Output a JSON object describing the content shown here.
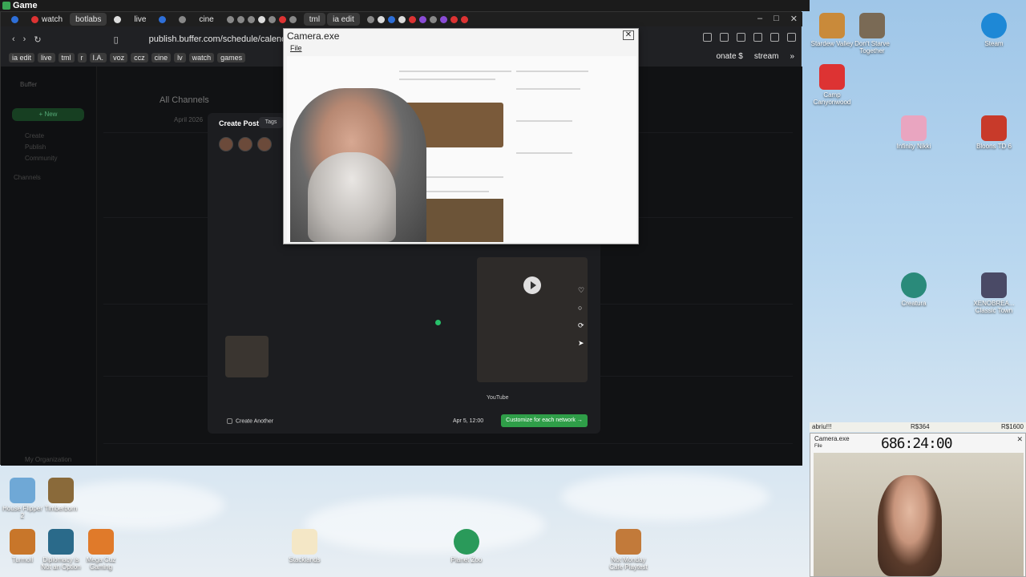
{
  "game_bar": {
    "title": "Game"
  },
  "browser": {
    "tabs": [
      {
        "label": "",
        "active": false
      },
      {
        "label": "watch",
        "active": false
      },
      {
        "label": "botlabs",
        "active": true
      },
      {
        "label": "",
        "active": false
      },
      {
        "label": "live",
        "active": false
      },
      {
        "label": "",
        "active": false
      },
      {
        "label": "",
        "active": false
      },
      {
        "label": "cine",
        "active": false
      },
      {
        "label": "",
        "active": false
      },
      {
        "label": "tml",
        "active": true
      },
      {
        "label": "ia edit",
        "active": true
      }
    ],
    "url": "publish.buffer.com/schedule/calendar",
    "bookmarks": [
      "ia edit",
      "live",
      "tml",
      "r",
      "I.A.",
      "voz",
      "ccz",
      "cine",
      "lv",
      "watch",
      "games"
    ],
    "bookmarks_right": [
      "onate $",
      "stream"
    ]
  },
  "buffer": {
    "brand": "Buffer",
    "create_label": "+ New",
    "sidebar_items": [
      "Create",
      "Publish",
      "Community",
      "Channels"
    ],
    "calendar_title": "All Channels",
    "month": "April 2026",
    "org_name": "My Organization",
    "modal": {
      "title": "Create Post",
      "tags_label": "Tags",
      "youtube_label": "YouTube",
      "create_another_label": "Create Another",
      "schedule_label": "Apr 5, 12:00",
      "customize_label": "Customize for each network →"
    }
  },
  "camera_window": {
    "title": "Camera.exe",
    "menu_file": "File"
  },
  "desktop_icons_right": [
    {
      "label": "Stardew Valley",
      "color": "#c98a3a"
    },
    {
      "label": "Don't Starve Together",
      "color": "#7a6a55"
    },
    {
      "label": "Steam",
      "color": "#1e88d6"
    },
    {
      "label": "Camp Canyonwood",
      "color": "#d33"
    },
    {
      "label": "Infinity Nikki",
      "color": "#e9a5c0"
    },
    {
      "label": "Bloons TD 6",
      "color": "#c83a2a"
    },
    {
      "label": "Creatura",
      "color": "#2a8a7a"
    },
    {
      "label": "XENOBREA... Classic Town",
      "color": "#4a4a66"
    }
  ],
  "desktop_icons_bottom": [
    {
      "label": "House Flipper 2",
      "color": "#6fa8d6"
    },
    {
      "label": "Timberborn",
      "color": "#8a6a3a"
    },
    {
      "label": "Turmoil",
      "color": "#c8762a"
    },
    {
      "label": "Diplomacy is Not an Option",
      "color": "#2a6a8a"
    },
    {
      "label": "Mega Cuz Gaming",
      "color": "#e07a2a"
    },
    {
      "label": "Stacklands",
      "color": "#f4e7c6"
    },
    {
      "label": "Planet Zoo",
      "color": "#2a9a5a"
    },
    {
      "label": "Not Monday Cafe Playtest",
      "color": "#c27a3a"
    }
  ],
  "overlay": {
    "goal_label": "abriu!!!",
    "goal_mid": "R$364",
    "goal_right": "R$1600",
    "camera_title": "Camera.exe",
    "camera_file": "File",
    "timer": "686:24:00"
  }
}
